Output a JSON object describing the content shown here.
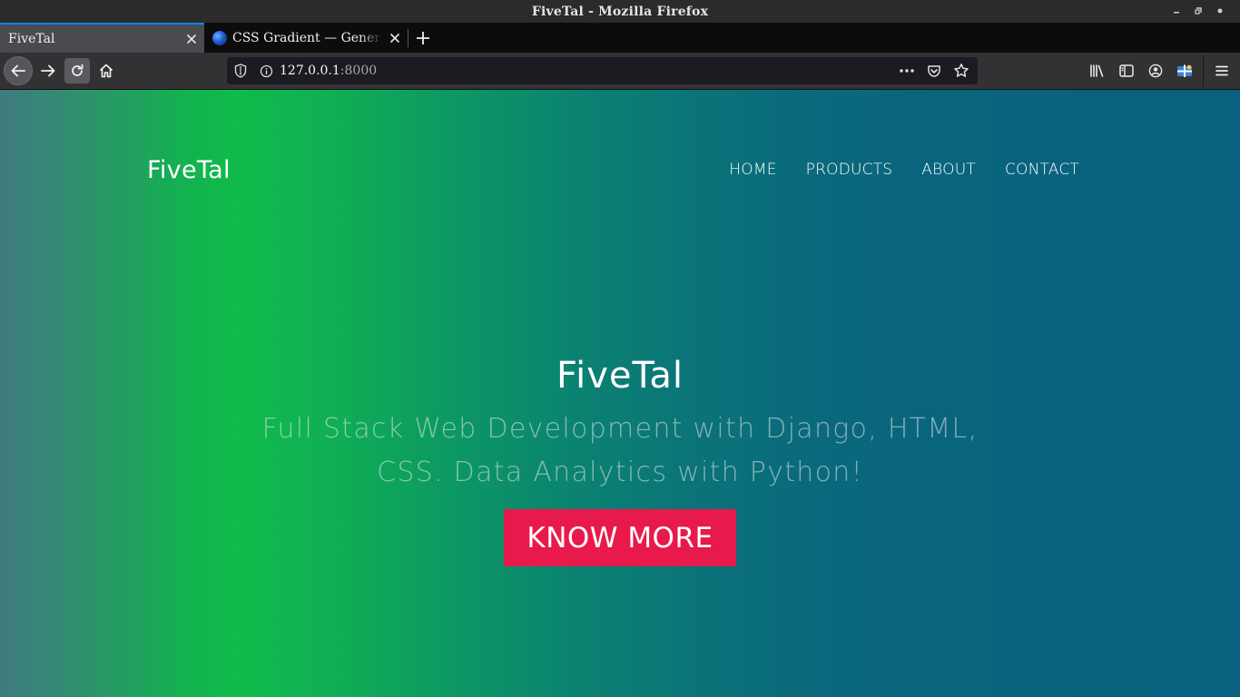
{
  "window": {
    "title": "FiveTal - Mozilla Firefox",
    "controls": [
      "minimize",
      "restore",
      "close"
    ]
  },
  "tabs": [
    {
      "label": "FiveTal",
      "active": true,
      "close_label": "✕"
    },
    {
      "label": "CSS Gradient — Generator",
      "active": false,
      "close_label": "✕",
      "favicon": "globe-icon"
    }
  ],
  "new_tab_label": "+",
  "navigation": {
    "url_host": "127.0.0.1",
    "url_port": ":8000",
    "icons": [
      "back-icon",
      "forward-icon",
      "reload-icon",
      "home-icon",
      "shield-icon",
      "info-icon",
      "more-icon",
      "pocket-icon",
      "star-icon",
      "library-icon",
      "sidebar-icon",
      "account-icon",
      "extension-icon",
      "menu-icon"
    ]
  },
  "site": {
    "brand": "FiveTal",
    "nav": [
      "HOME",
      "PRODUCTS",
      "ABOUT",
      "CONTACT"
    ],
    "hero": {
      "title": "FiveTal",
      "subtitle": "Full Stack Web Development with Django, HTML, CSS. Data Analytics with Python!",
      "cta": "KNOW MORE"
    }
  },
  "colors": {
    "cta_background": "#e8194b",
    "gradient_left": "#3f7a82",
    "gradient_green": "#0fbb4a",
    "gradient_right": "#08617f",
    "tab_accent": "#0a84ff"
  }
}
